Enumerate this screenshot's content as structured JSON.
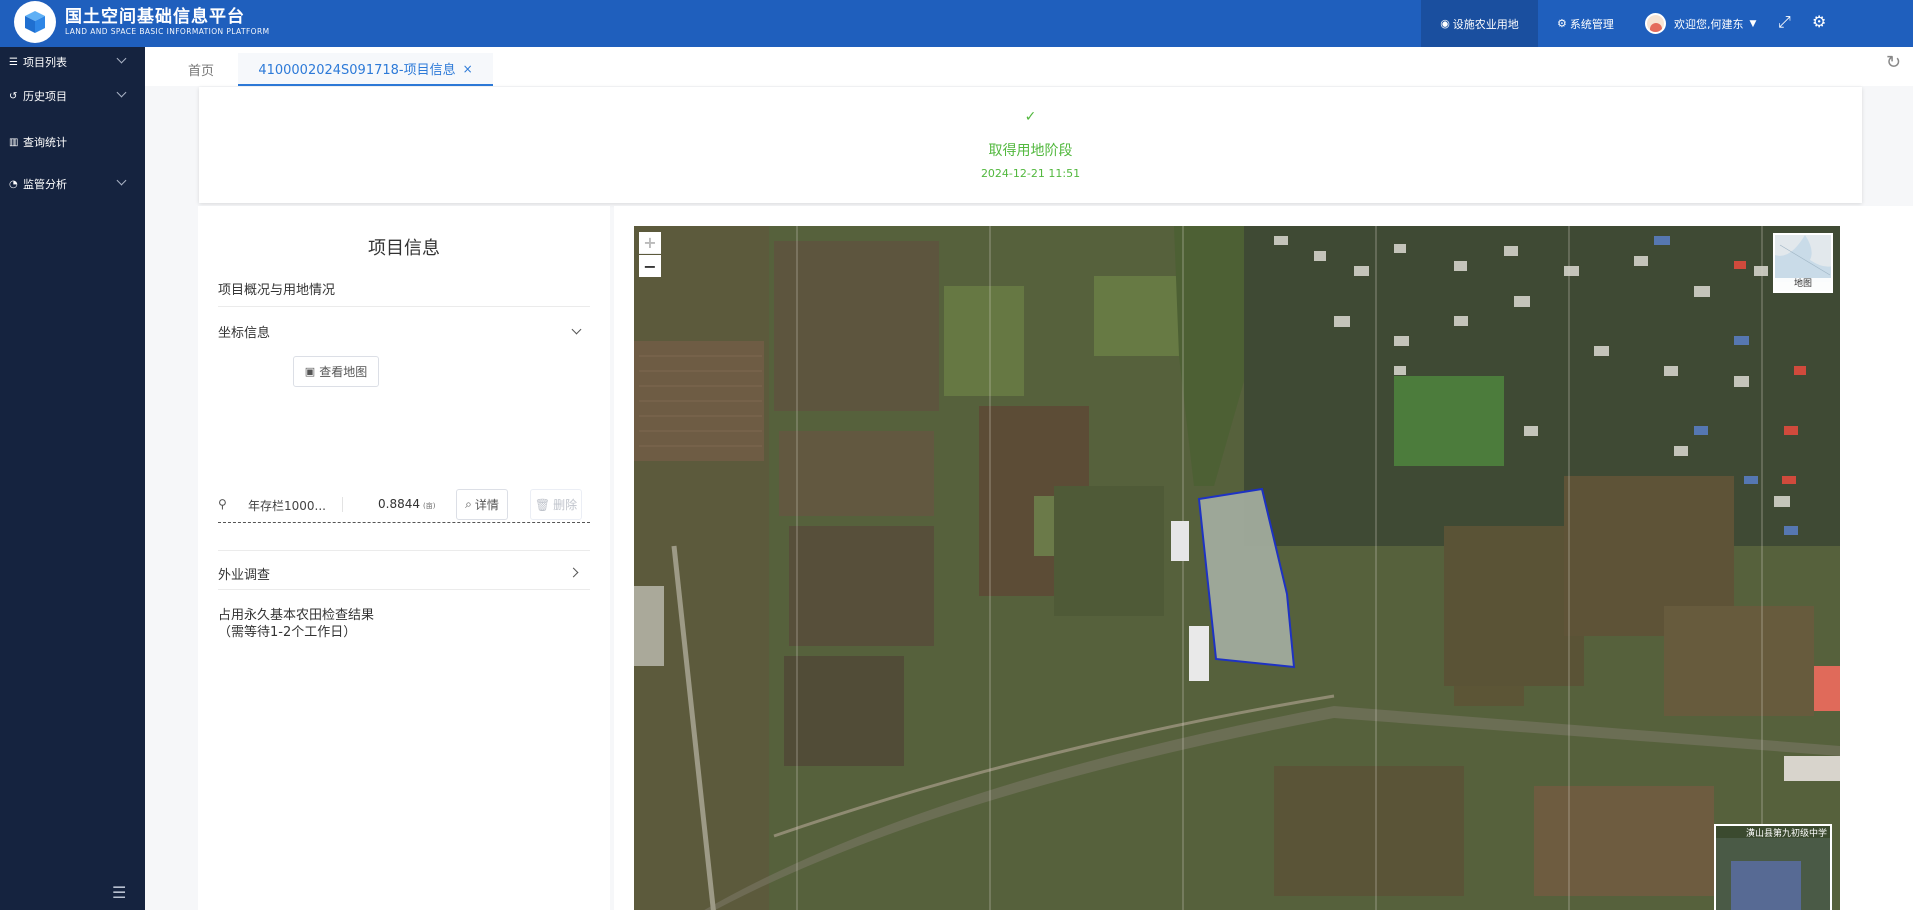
{
  "header": {
    "brand_title": "国土空间基础信息平台",
    "brand_subtitle": "LAND AND SPACE BASIC INFORMATION PLATFORM",
    "nav_active": "设施农业用地",
    "nav_system": "系统管理",
    "user_greeting": "欢迎您,何建东"
  },
  "sidebar": {
    "items": [
      {
        "label": "项目列表",
        "icon": "list-icon"
      },
      {
        "label": "历史项目",
        "icon": "history-icon"
      },
      {
        "label": "查询统计",
        "icon": "bar-chart-icon"
      },
      {
        "label": "监管分析",
        "icon": "analysis-icon"
      }
    ]
  },
  "tabs": {
    "home": "首页",
    "active": "4100002024S091718-项目信息",
    "close": "×"
  },
  "stage": {
    "check": "✓",
    "name": "取得用地阶段",
    "date": "2024-12-21 11:51"
  },
  "project": {
    "title": "项目信息",
    "overview_label": "项目概况与用地情况",
    "coord_label": "坐标信息",
    "view_map_button": "查看地图",
    "parcel": {
      "name": "年存栏1000...",
      "area": "0.8844",
      "unit": "(亩)",
      "detail_button": "详情",
      "delete_button": "删除"
    },
    "field_survey_label": "外业调查",
    "farmland_result_line1": "占用永久基本农田检查结果",
    "farmland_result_line2": "（需等待1-2个工作日）"
  },
  "map": {
    "zoom_in": "+",
    "zoom_out": "−",
    "basemap_label": "地图",
    "overview_label": "潢山县第九初级中学"
  },
  "colors": {
    "header_bg": "#1f5fbd",
    "sidebar_bg": "#15233f",
    "accent": "#2d7ad8",
    "success": "#52b83e"
  }
}
